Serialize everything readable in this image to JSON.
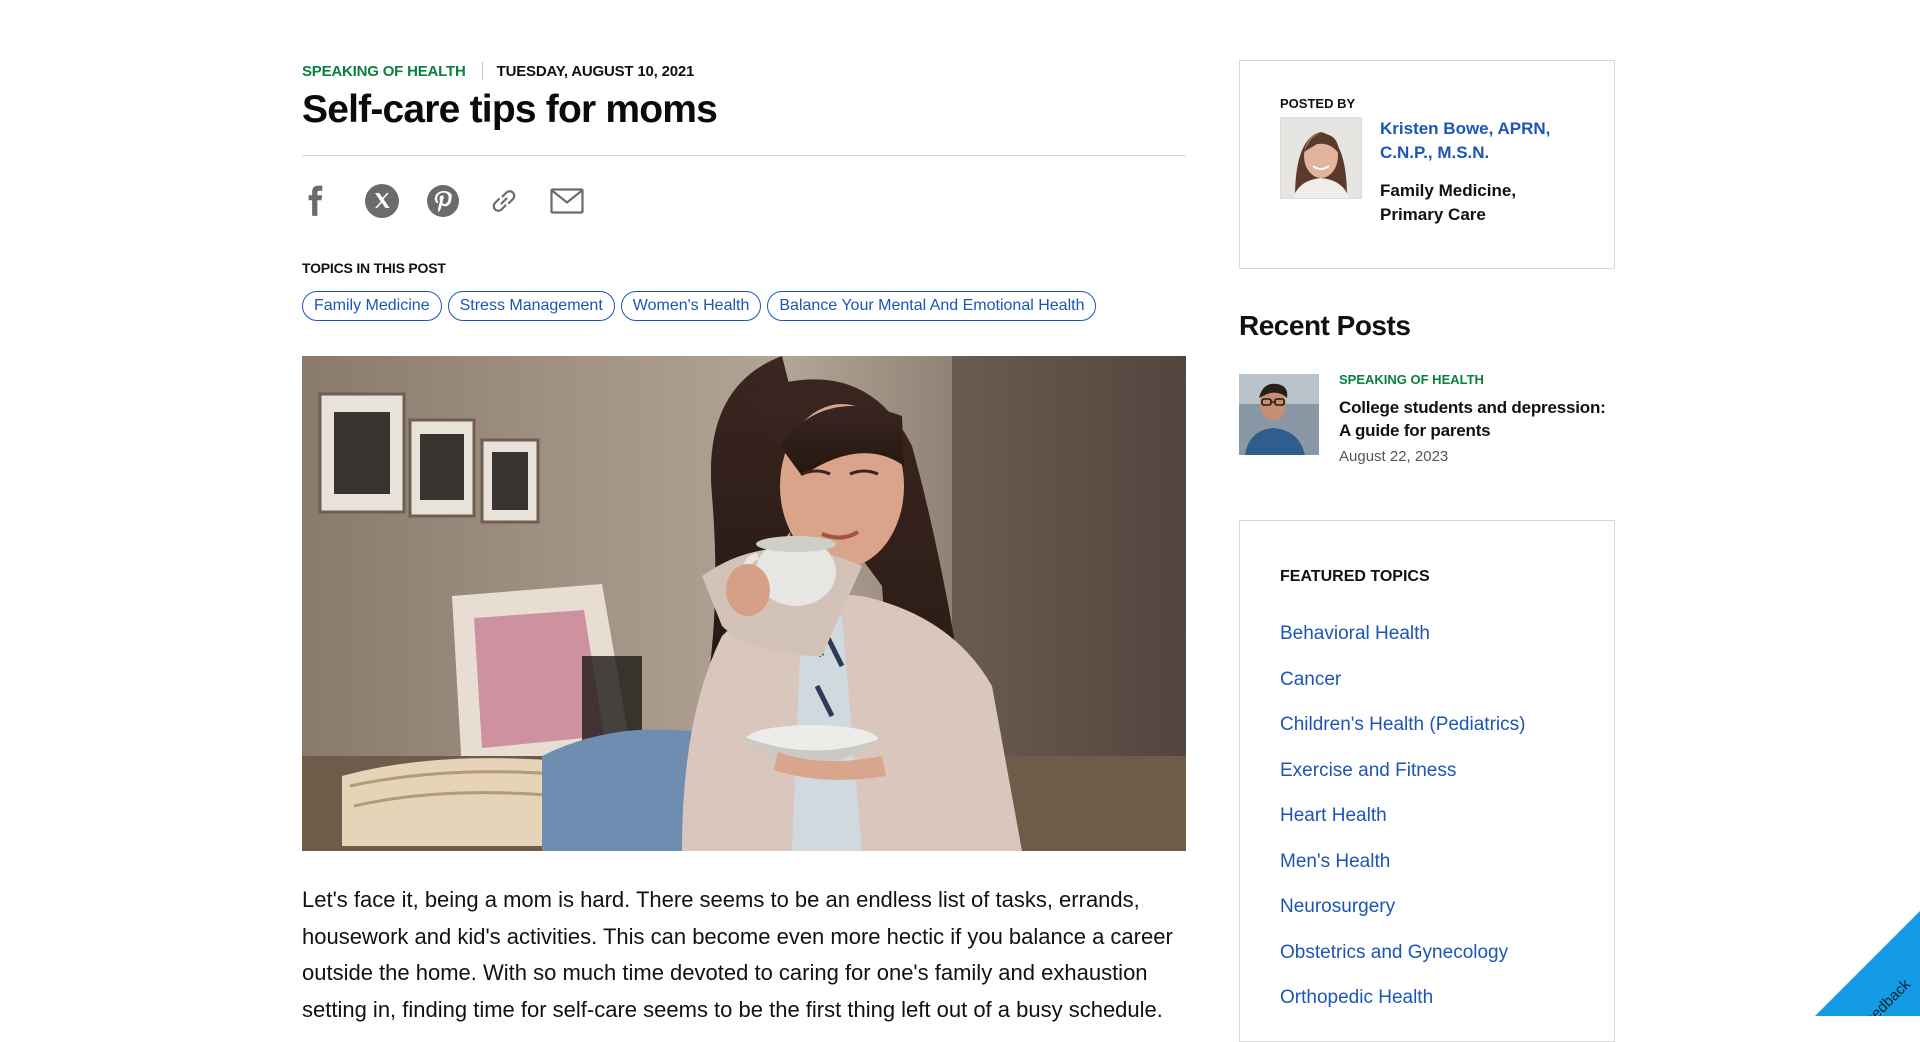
{
  "article": {
    "category": "SPEAKING OF HEALTH",
    "date": "TUESDAY, AUGUST 10, 2021",
    "title": "Self-care tips for moms",
    "share_icons": [
      "facebook-icon",
      "x-icon",
      "pinterest-icon",
      "link-icon",
      "email-icon"
    ],
    "topics_label": "TOPICS IN THIS POST",
    "topics": [
      "Family Medicine",
      "Stress Management",
      "Women's Health",
      "Balance Your Mental And Emotional Health"
    ],
    "body": "Let's face it, being a mom is hard. There seems to be an endless list of tasks, errands, housework and kid's activities. This can become even more hectic if you balance a career outside the home. With so much time devoted to caring for one's family and exhaustion setting in, finding time for self-care seems to be the first thing left out of a busy schedule."
  },
  "author": {
    "posted_by_label": "POSTED BY",
    "name": "Kristen Bowe, APRN, C.N.P., M.S.N.",
    "department": "Family Medicine, Primary Care"
  },
  "recent": {
    "heading": "Recent Posts",
    "items": [
      {
        "category": "SPEAKING OF HEALTH",
        "title": "College students and depression: A guide for parents",
        "date": "August 22, 2023"
      }
    ]
  },
  "featured": {
    "heading": "FEATURED TOPICS",
    "topics": [
      "Behavioral Health",
      "Cancer",
      "Children's Health (Pediatrics)",
      "Exercise and Fitness",
      "Heart Health",
      "Men's Health",
      "Neurosurgery",
      "Obstetrics and Gynecology",
      "Orthopedic Health"
    ]
  },
  "feedback": {
    "label": "Feedback"
  },
  "colors": {
    "accent_green": "#0a7f3f",
    "link_blue": "#1c55b6",
    "feedback_blue": "#139be6"
  }
}
